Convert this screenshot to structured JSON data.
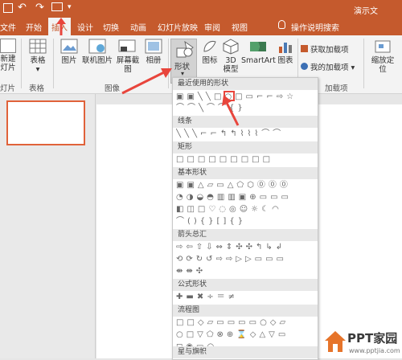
{
  "titlebar": {
    "title": "演示文"
  },
  "tabs": [
    "文件",
    "开始",
    "插入",
    "设计",
    "切换",
    "动画",
    "幻灯片放映",
    "审阅",
    "视图"
  ],
  "active_tab": "插入",
  "tell_me": "操作说明搜索",
  "ribbon": {
    "new_slide": "新建\n幻灯片",
    "new_slide_label": "新建",
    "new_slide_label2": "灯片",
    "table": "表格",
    "picture": "图片",
    "online_picture": "联机图片",
    "screenshot": "屏幕截图",
    "album": "相册",
    "shapes": "形状",
    "icons": "图标",
    "model3d_1": "3D",
    "model3d_2": "模型",
    "smartart": "SmartArt",
    "chart": "图表",
    "get_addins": "获取加载项",
    "my_addins": "我的加载项",
    "zoom_1": "缩放定",
    "zoom_2": "位",
    "group_slides": "灯片",
    "group_table": "表格",
    "group_images": "图像",
    "group_addins": "加载项"
  },
  "dropdown": {
    "recent": "最近使用的形状",
    "lines": "线条",
    "rect": "矩形",
    "basic": "基本形状",
    "arrows": "箭头总汇",
    "equation": "公式形状",
    "flowchart": "流程图",
    "stars": "星与旗帜",
    "row_recent1": "▣▣╲╲□○□▭⌐⌐⇨☆",
    "row_recent2": "⌒⌒╲⌒⌒{}",
    "row_lines": "╲╲╲⌐⌐↰↰⌇⌇⌇⌒⌒",
    "row_rect": "□□□□□□□□□",
    "row_basic1": "▣▣△▱▭△⬠⬡⓪⓪⓪",
    "row_basic2": "◔◑◒◓▥▥▣⊕▭▭▭",
    "row_basic3": "◧◫□♡◌◎☺☼☾◠",
    "row_basic4": "⌒(){}[]{}",
    "row_arrows1": "⇨⇦⇧⇩⇔⇕✣✣↰↳↲",
    "row_arrows2": "⟲⟳↻↺⇨⇨▷▷▭▭▭",
    "row_arrows3": "⇼⇼✣",
    "row_equation": "✚▬✖÷＝≠",
    "row_flow1": "□□◇▱▭▭▭▭○◇▱",
    "row_flow2": "○□▽⬠⊗⊕⌛◇△▽▭",
    "row_flow3": "◻◉▭○",
    "row_stars": "✷✶☆☆✪✪✪✪✪"
  },
  "watermark": {
    "brand": "PPT家园",
    "url": "www.pptjia.com"
  },
  "colors": {
    "accent": "#c55a2d",
    "arrow": "#e8453c"
  }
}
